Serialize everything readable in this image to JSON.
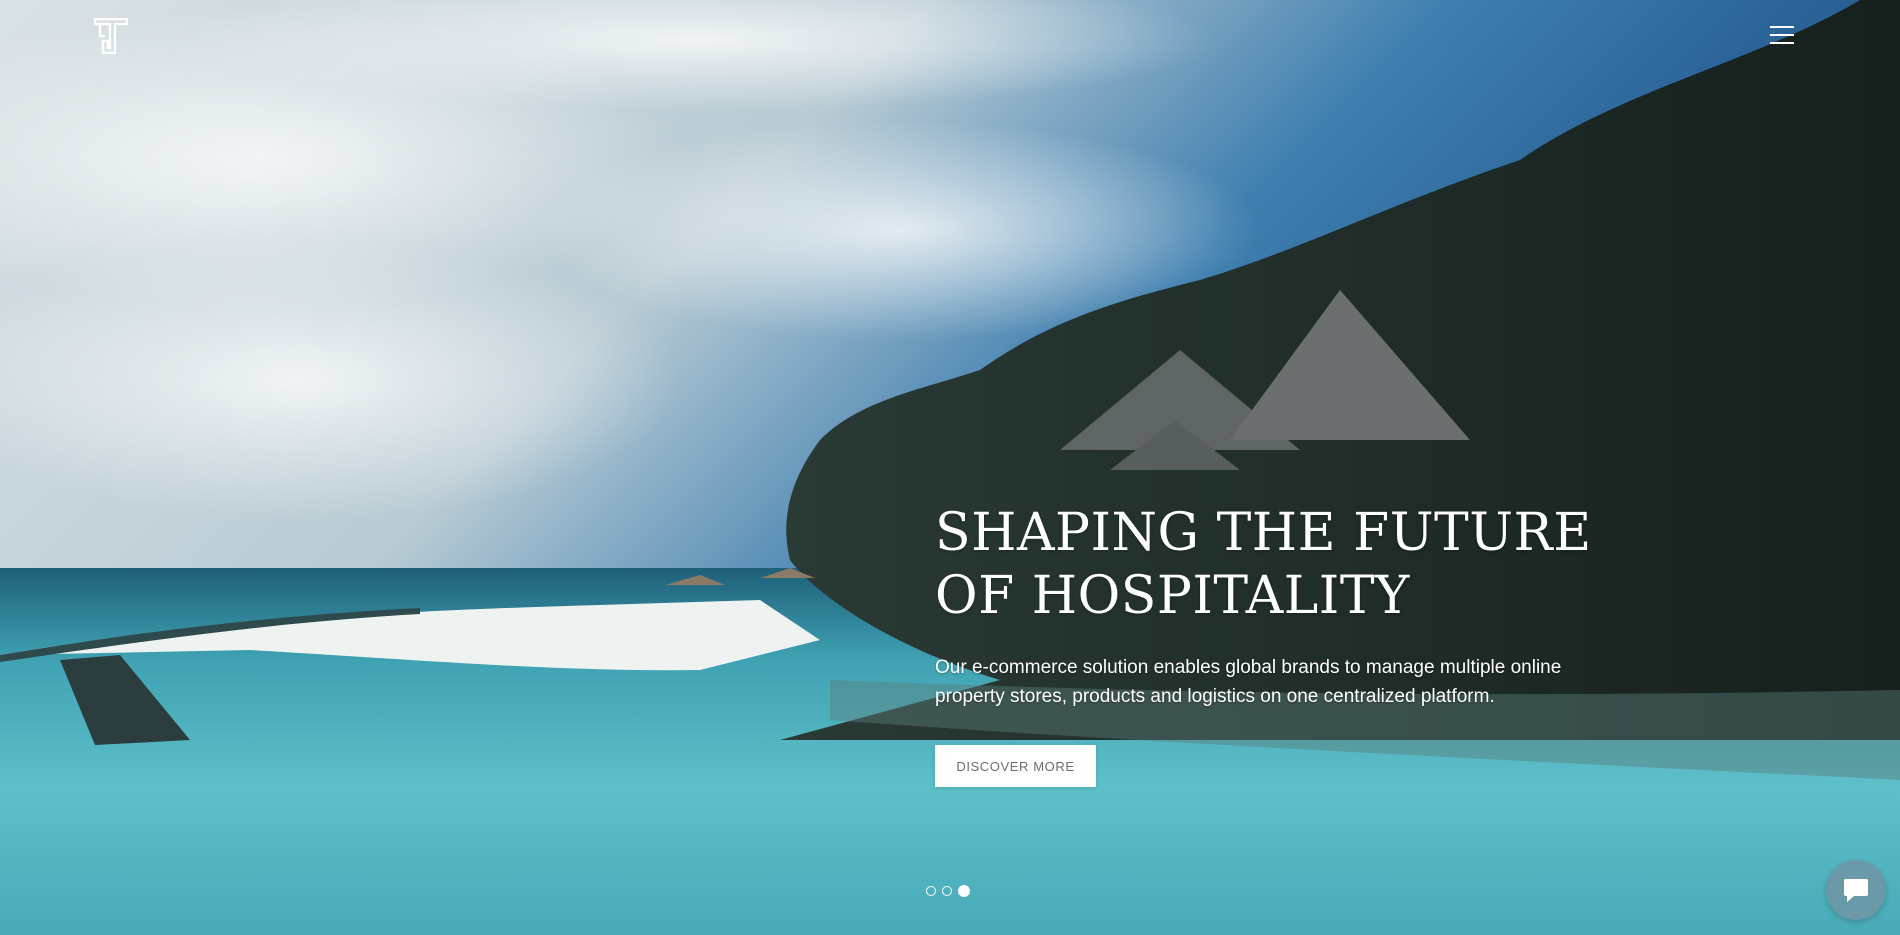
{
  "header": {
    "logo_icon": "monogram-logo",
    "menu_icon": "hamburger-menu-icon"
  },
  "hero": {
    "headline_line1": "SHAPING THE FUTURE",
    "headline_line2": "OF HOSPITALITY",
    "description": "Our e-commerce solution enables global brands to manage multiple online property stores, products and logistics on one centralized platform.",
    "cta_label": "DISCOVER MORE"
  },
  "carousel": {
    "slide_count": 3,
    "active_slide": 3
  },
  "chat": {
    "icon": "chat-bubble-icon"
  },
  "colors": {
    "text": "#ffffff",
    "button_bg": "#ffffff",
    "button_text": "#6e6e6e",
    "chat_button": "#6a9aa8"
  }
}
